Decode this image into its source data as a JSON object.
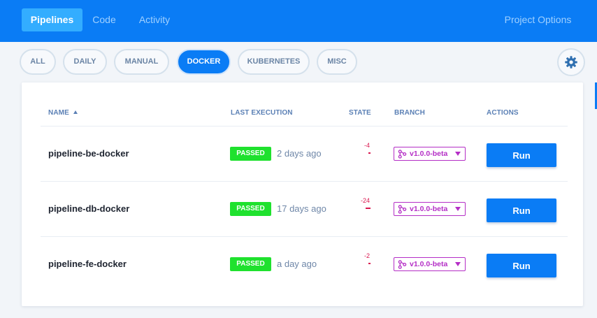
{
  "nav": {
    "tabs": [
      {
        "label": "Pipelines",
        "active": true
      },
      {
        "label": "Code",
        "active": false
      },
      {
        "label": "Activity",
        "active": false
      }
    ],
    "project_options": "Project Options"
  },
  "filters": {
    "items": [
      "ALL",
      "DAILY",
      "MANUAL",
      "DOCKER",
      "KUBERNETES",
      "MISC"
    ],
    "active": "DOCKER",
    "settings_icon": "gear-icon"
  },
  "table": {
    "columns": {
      "name": "NAME",
      "last_execution": "LAST EXECUTION",
      "state": "STATE",
      "branch": "BRANCH",
      "actions": "ACTIONS"
    },
    "sort_indicator": "ascending",
    "rows": [
      {
        "name": "pipeline-be-docker",
        "status": "PASSED",
        "last_run": "2 days ago",
        "state": "-4",
        "branch": "v1.0.0-beta",
        "action": "Run"
      },
      {
        "name": "pipeline-db-docker",
        "status": "PASSED",
        "last_run": "17 days ago",
        "state": "-24",
        "branch": "v1.0.0-beta",
        "action": "Run"
      },
      {
        "name": "pipeline-fe-docker",
        "status": "PASSED",
        "last_run": "a day ago",
        "state": "-2",
        "branch": "v1.0.0-beta",
        "action": "Run"
      }
    ]
  },
  "colors": {
    "primary": "#0a7cf5",
    "passed": "#1fe12e",
    "branch": "#b42ec6",
    "state": "#d9174f"
  }
}
